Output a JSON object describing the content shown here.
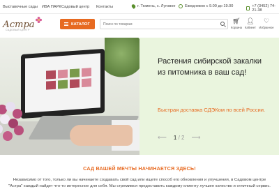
{
  "topbar": {
    "nav": [
      "Выставочные сады",
      "ИВА ПАРК",
      "Садовый центр",
      "Контакты"
    ],
    "city": "г. Тюмень, с. Луговое",
    "hours": "Ежедневно с 9.00 до 19.00",
    "phone": "+7 (3452) 74-21-38"
  },
  "header": {
    "logo": "Астра",
    "logo_sub": "САДОВЫЙ ЦЕНТР",
    "catalog_label": "КАТАЛОГ",
    "search_placeholder": "Поиск по товарам",
    "icons": [
      {
        "label": "Корзина",
        "icon": "cart-icon"
      },
      {
        "label": "Кабинет",
        "icon": "user-icon"
      },
      {
        "label": "Избранное",
        "icon": "heart-icon"
      }
    ]
  },
  "hero": {
    "title": "Растения сибирской закалки из питомника в ваш сад!",
    "delivery": "Быстрая доставка СДЭКом по всей России.",
    "slide_current": "1",
    "slide_total": "/ 2"
  },
  "section": {
    "title": "САД ВАШЕЙ МЕЧТЫ НАЧИНАЕТСЯ ЗДЕСЬ!",
    "text": "Независимо от того, только ли вы начинаете создавать свой сад или ищете способ его обновления и улучшения, в Садовом центре \"Астра\" каждый найдет что-то интересное для себя.  Мы стремимся предоставить каждому клиенту лучшее качество и отличный сервис."
  },
  "colors": {
    "accent": "#e76a21",
    "promo_bg": "#eaf5de",
    "green": "#5a8f2c"
  }
}
